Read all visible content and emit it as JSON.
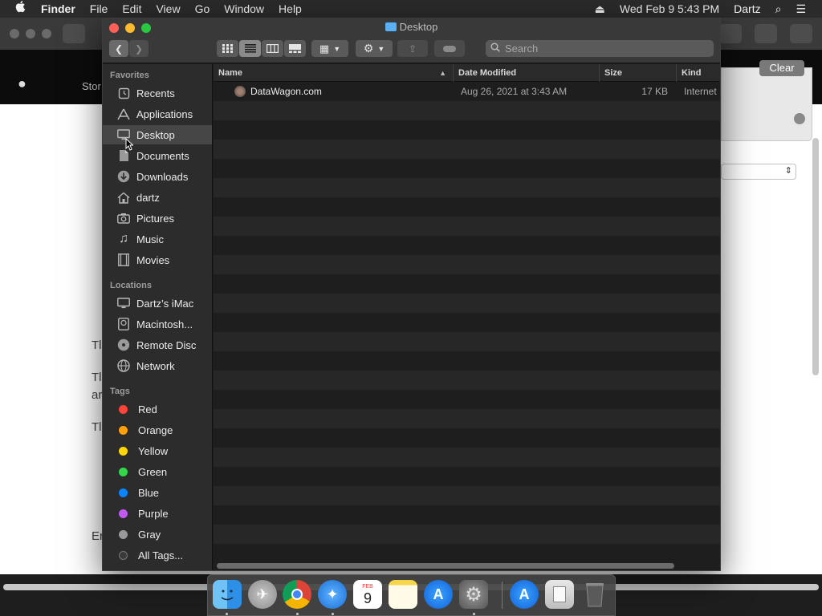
{
  "menubar": {
    "apple": "",
    "app_name": "Finder",
    "items": [
      "File",
      "Edit",
      "View",
      "Go",
      "Window",
      "Help"
    ],
    "eject": "⏏",
    "clock": "Wed Feb 9  5:43 PM",
    "user": "Dartz",
    "spotlight": "⌕",
    "control": "☰"
  },
  "background": {
    "store_text": "Stor",
    "clear_label": "Clear",
    "text_snippets": [
      "Tl",
      "Tl",
      "ar",
      "Tl",
      "Er"
    ]
  },
  "finder": {
    "window_title": "Desktop",
    "search_placeholder": "Search",
    "sidebar": {
      "favorites_header": "Favorites",
      "favorites": [
        {
          "label": "Recents",
          "icon": "clock-icon"
        },
        {
          "label": "Applications",
          "icon": "applications-icon"
        },
        {
          "label": "Desktop",
          "icon": "desktop-icon"
        },
        {
          "label": "Documents",
          "icon": "document-icon"
        },
        {
          "label": "Downloads",
          "icon": "download-icon"
        },
        {
          "label": "dartz",
          "icon": "home-icon"
        },
        {
          "label": "Pictures",
          "icon": "camera-icon"
        },
        {
          "label": "Music",
          "icon": "music-icon"
        },
        {
          "label": "Movies",
          "icon": "film-icon"
        }
      ],
      "locations_header": "Locations",
      "locations": [
        {
          "label": "Dartz’s iMac",
          "icon": "computer-icon"
        },
        {
          "label": "Macintosh...",
          "icon": "harddisk-icon"
        },
        {
          "label": "Remote Disc",
          "icon": "disc-icon"
        },
        {
          "label": "Network",
          "icon": "globe-icon"
        }
      ],
      "tags_header": "Tags",
      "tags": [
        {
          "label": "Red",
          "color": "#ff453a"
        },
        {
          "label": "Orange",
          "color": "#ff9f0a"
        },
        {
          "label": "Yellow",
          "color": "#ffd60a"
        },
        {
          "label": "Green",
          "color": "#32d74b"
        },
        {
          "label": "Blue",
          "color": "#0a84ff"
        },
        {
          "label": "Purple",
          "color": "#bf5af2"
        },
        {
          "label": "Gray",
          "color": "#98989d"
        }
      ],
      "all_tags": "All Tags..."
    },
    "columns": {
      "name": "Name",
      "date": "Date Modified",
      "size": "Size",
      "kind": "Kind"
    },
    "file": {
      "name": "DataWagon.com",
      "date": "Aug 26, 2021 at 3:43 AM",
      "size": "17 KB",
      "kind": "Internet"
    }
  },
  "dock": {
    "apps": [
      "finder-icon",
      "launchpad-icon",
      "chrome-icon",
      "safari-icon",
      "calendar-icon",
      "notes-icon",
      "app-store-icon",
      "system-preferences-icon",
      "app-store-icon",
      "document-icon",
      "trash-icon"
    ],
    "calendar_month": "FEB",
    "calendar_day": "9"
  }
}
